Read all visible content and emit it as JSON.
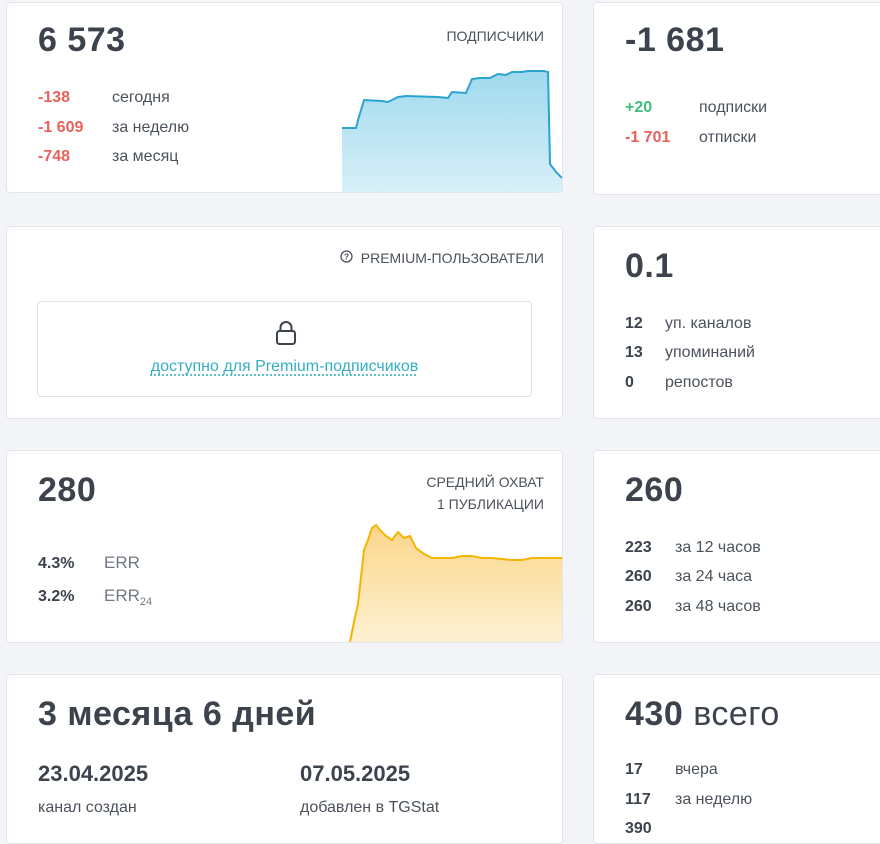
{
  "subscribers": {
    "total": "6 573",
    "label": "ПОДПИСЧИКИ",
    "rows": [
      {
        "value": "-138",
        "text": "сегодня"
      },
      {
        "value": "-1 609",
        "text": "за неделю"
      },
      {
        "value": "-748",
        "text": "за месяц"
      }
    ],
    "chart_color": "#3aaed3"
  },
  "net": {
    "total": "-1 681",
    "rows": [
      {
        "value": "+20",
        "text": "подписки"
      },
      {
        "value": "-1 701",
        "text": "отписки"
      }
    ]
  },
  "premium": {
    "label": "PREMIUM-ПОЛЬЗОВАТЕЛИ",
    "help_icon": "question-circle-icon",
    "lock_icon": "lock-icon",
    "link_text": "доступно для Premium-подписчиков"
  },
  "citation": {
    "total": "0.1",
    "rows": [
      {
        "value": "12",
        "text": "уп. каналов"
      },
      {
        "value": "13",
        "text": "упоминаний"
      },
      {
        "value": "0",
        "text": "репостов"
      }
    ]
  },
  "reach": {
    "total": "280",
    "label_line1": "СРЕДНИЙ ОХВАТ",
    "label_line2": "1 ПУБЛИКАЦИИ",
    "rows": [
      {
        "value": "4.3%",
        "text": "ERR",
        "sub": ""
      },
      {
        "value": "3.2%",
        "text": "ERR",
        "sub": "24"
      }
    ],
    "chart_color": "#f6b81c"
  },
  "views": {
    "total": "260",
    "rows": [
      {
        "value": "223",
        "text": "за 12 часов"
      },
      {
        "value": "260",
        "text": "за 24 часа"
      },
      {
        "value": "260",
        "text": "за 48 часов"
      }
    ]
  },
  "age": {
    "total": "3 месяца 6 дней",
    "created_date": "23.04.2025",
    "created_label": "канал создан",
    "added_date": "07.05.2025",
    "added_label": "добавлен в TGStat"
  },
  "posts": {
    "count": "430",
    "count_suffix": "всего",
    "rows": [
      {
        "value": "17",
        "text": "вчера"
      },
      {
        "value": "117",
        "text": "за неделю"
      },
      {
        "value": "390",
        "text": ""
      }
    ]
  }
}
